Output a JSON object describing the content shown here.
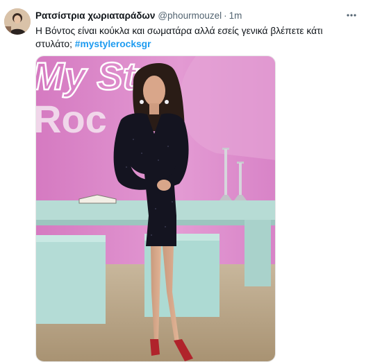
{
  "tweet": {
    "display_name": "Ρατσίστρια χωριαταράδων",
    "handle": "@phourmouzel",
    "separator": "·",
    "time": "1m",
    "text": "Η Βόντος είναι κούκλα και σωματάρα αλλά εσείς γενικά βλέπετε κάτι στυλάτο;",
    "hashtag": "#mystylerocksgr",
    "more_icon": "more-horizontal-icon",
    "avatar_icon": "profile-avatar"
  },
  "media": {
    "backdrop_text_line1": "My Sty",
    "backdrop_text_line2": "Roc",
    "colors": {
      "backdrop": "#d87fc3",
      "backdrop_light": "#e7a3d6",
      "counter": "#a9d3cd",
      "floor": "#b8a58a",
      "dress": "#141420"
    }
  }
}
